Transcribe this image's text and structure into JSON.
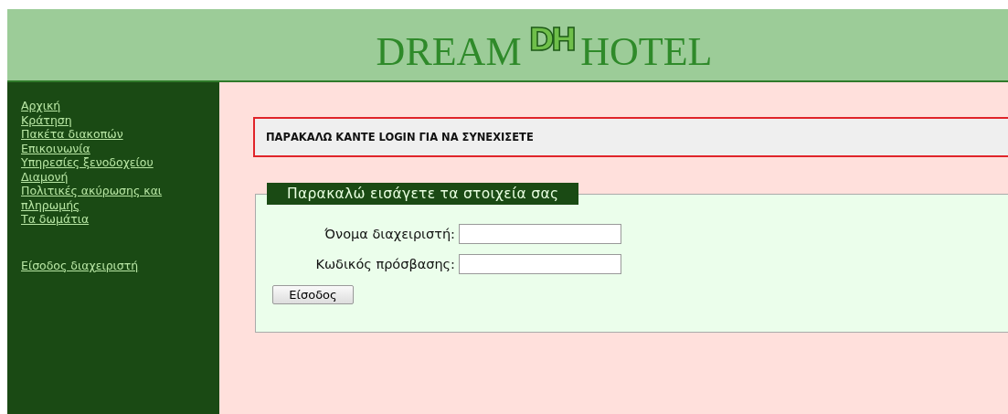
{
  "header": {
    "title_left": "DREAM",
    "logo_mark": "DH",
    "title_right": "HOTEL"
  },
  "sidebar": {
    "items": [
      {
        "label": "Αρχική"
      },
      {
        "label": "Κράτηση"
      },
      {
        "label": "Πακέτα διακοπών"
      },
      {
        "label": "Επικοινωνία"
      },
      {
        "label": "Υπηρεσίες ξενοδοχείου"
      },
      {
        "label": "Διαμονή"
      },
      {
        "label": "Πολιτικές ακύρωσης και πληρωμής"
      },
      {
        "label": "Τα δωμάτια"
      }
    ],
    "admin_link": "Είσοδος διαχειριστή"
  },
  "alert": {
    "message": "ΠΑΡΑΚΑΛΩ ΚΑΝΤΕ LOGIN ΓΙΑ ΝΑ ΣΥΝΕΧΙΣΕΤΕ"
  },
  "login_form": {
    "legend": "Παρακαλώ εισάγετε τα στοιχεία σας",
    "fields": [
      {
        "label": "Όνομα διαχειριστή:"
      },
      {
        "label": "Κωδικός πρόσβασης:"
      }
    ],
    "submit": "Είσοδος"
  }
}
